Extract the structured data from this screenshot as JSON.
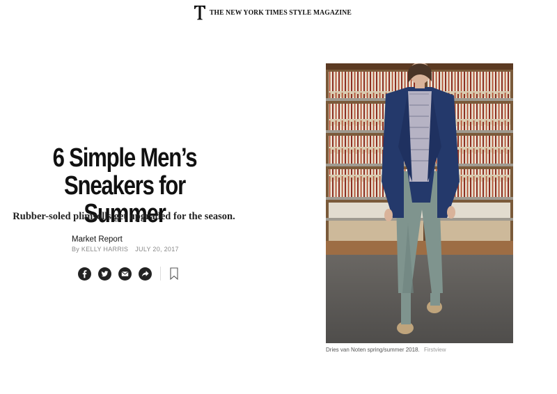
{
  "masthead": {
    "logo_letter": "T",
    "title": "THE NEW YORK TIMES STYLE MAGAZINE"
  },
  "article": {
    "headline": "6 Simple Men’s\nSneakers for Summer",
    "summary": "Rubber-soled plimsolls get upgraded for the season.",
    "kicker": "Market Report",
    "byline_prefix": "By",
    "author": "KELLY HARRIS",
    "date": "JULY 20, 2017"
  },
  "share": {
    "items": [
      {
        "icon": "facebook-icon"
      },
      {
        "icon": "twitter-icon"
      },
      {
        "icon": "email-icon"
      },
      {
        "icon": "share-arrow-icon"
      }
    ],
    "save_icon": "bookmark-icon"
  },
  "photo": {
    "caption": "Dries van Noten spring/summer 2018.",
    "credit": "Firstview"
  },
  "colors": {
    "text": "#111111",
    "meta_gray": "#888888",
    "icon_fill": "#222222"
  }
}
